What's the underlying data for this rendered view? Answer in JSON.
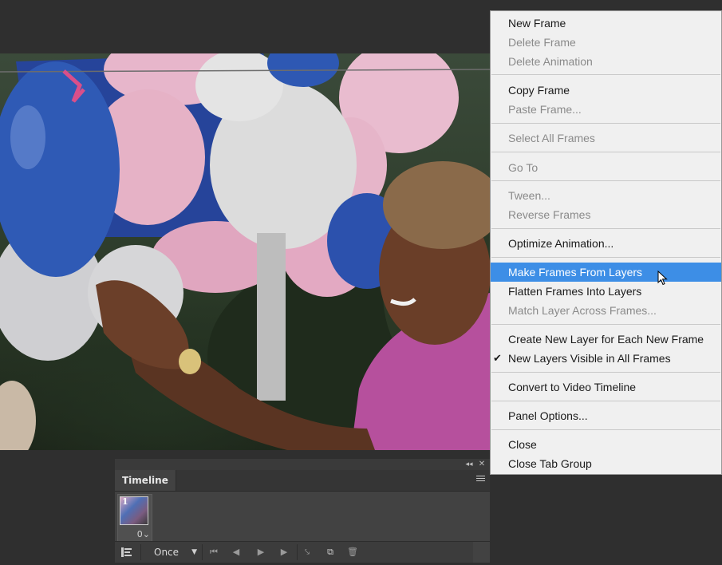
{
  "menu": {
    "items": [
      {
        "label": "New Frame",
        "enabled": true
      },
      {
        "label": "Delete Frame",
        "enabled": false
      },
      {
        "label": "Delete Animation",
        "enabled": false
      },
      {
        "label": "Copy Frame",
        "enabled": true
      },
      {
        "label": "Paste Frame...",
        "enabled": false
      },
      {
        "label": "Select All Frames",
        "enabled": false
      },
      {
        "label": "Go To",
        "enabled": false
      },
      {
        "label": "Tween...",
        "enabled": false
      },
      {
        "label": "Reverse Frames",
        "enabled": false
      },
      {
        "label": "Optimize Animation...",
        "enabled": true
      },
      {
        "label": "Make Frames From Layers",
        "enabled": true,
        "highlighted": true
      },
      {
        "label": "Flatten Frames Into Layers",
        "enabled": true
      },
      {
        "label": "Match Layer Across Frames...",
        "enabled": false
      },
      {
        "label": "Create New Layer for Each New Frame",
        "enabled": true
      },
      {
        "label": "New Layers Visible in All Frames",
        "enabled": true,
        "checked": true
      },
      {
        "label": "Convert to Video Timeline",
        "enabled": true
      },
      {
        "label": "Panel Options...",
        "enabled": true
      },
      {
        "label": "Close",
        "enabled": true
      },
      {
        "label": "Close Tab Group",
        "enabled": true
      }
    ],
    "check_glyph": "✔"
  },
  "timeline": {
    "tab_label": "Timeline",
    "frame": {
      "number": "1",
      "delay": "0"
    },
    "loop": "Once",
    "collapse_glyph": "◂◂",
    "close_glyph": "✕"
  },
  "colors": {
    "highlight": "#3d8ee6",
    "menu_bg": "#f0f0f0",
    "app_bg": "#2f2f2f"
  }
}
